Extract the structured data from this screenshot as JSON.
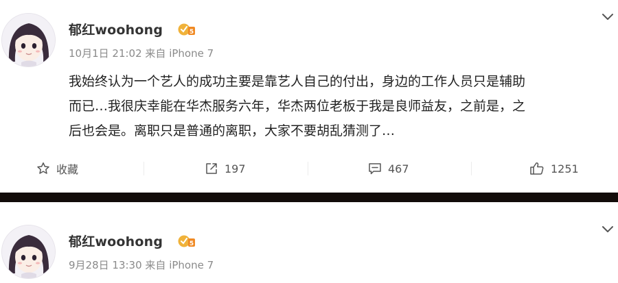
{
  "posts": [
    {
      "username": "郁红woohong",
      "date": "10月1日 21:02",
      "source": "来自 iPhone 7",
      "content_lines": [
        "我始终认为一个艺人的成功主要是靠艺人自己的付出，身边的工作人员只是辅助",
        "而已…我很庆幸能在华杰服务六年，华杰两位老板于我是良师益友，之前是，之",
        "后也会是。离职只是普通的离职，大家不要胡乱猜测了…"
      ],
      "actions": {
        "favorite_label": "收藏",
        "repost_count": "197",
        "comment_count": "467",
        "like_count": "1251"
      }
    },
    {
      "username": "郁红woohong",
      "date": "9月28日 13:30",
      "source": "来自 iPhone 7"
    }
  ],
  "colors": {
    "divider": "#120c0a",
    "vip_badge": "#f0b23a",
    "meta_text": "#8a8a8a"
  },
  "icons": [
    "avatar-image",
    "vip-badge-icon",
    "chevron-down-icon",
    "star-icon",
    "repost-icon",
    "comment-icon",
    "thumbs-up-icon"
  ]
}
